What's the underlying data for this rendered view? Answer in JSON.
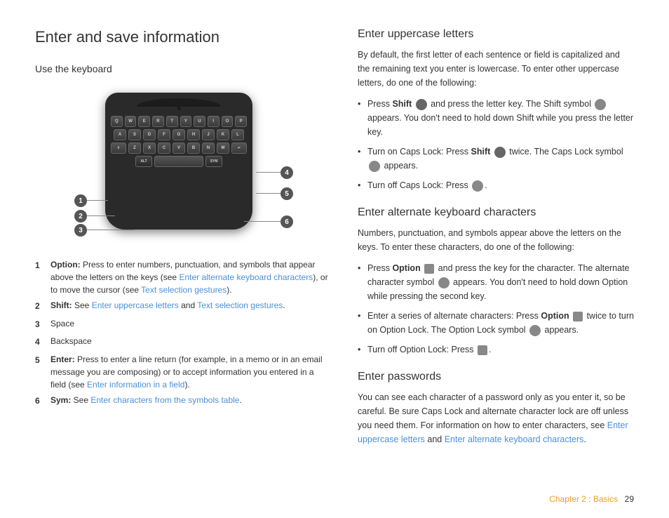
{
  "page": {
    "title": "Enter and save information",
    "left": {
      "section_title": "Use the keyboard",
      "legend": [
        {
          "num": "1",
          "label": "Option:",
          "text": " Press to enter numbers, punctuation, and symbols that appear above the letters on the keys (see ",
          "link1_text": "Enter alternate keyboard characters",
          "link1_href": "#",
          "text2": "), or to move the cursor (see ",
          "link2_text": "Text selection gestures",
          "link2_href": "#",
          "text3": ")."
        },
        {
          "num": "2",
          "label": "Shift:",
          "text": " See ",
          "link1_text": "Enter uppercase letters",
          "link1_href": "#",
          "text2": " and ",
          "link2_text": "Text selection gestures",
          "link2_href": "#",
          "text3": "."
        },
        {
          "num": "3",
          "label": "Space",
          "text": "",
          "link1_text": "",
          "text2": "",
          "link2_text": "",
          "text3": ""
        },
        {
          "num": "4",
          "label": "Backspace",
          "text": "",
          "link1_text": "",
          "text2": "",
          "link2_text": "",
          "text3": ""
        },
        {
          "num": "5",
          "label": "Enter:",
          "text": " Press to enter a line return (for example, in a memo or in an email message you are composing) or to accept information you entered in a field (see ",
          "link1_text": "Enter information in a field",
          "link1_href": "#",
          "text2": ").",
          "link2_text": "",
          "text3": ""
        },
        {
          "num": "6",
          "label": "Sym:",
          "text": " See ",
          "link1_text": "Enter characters from the symbols table",
          "link1_href": "#",
          "text2": ".",
          "link2_text": "",
          "text3": ""
        }
      ]
    },
    "right": {
      "sections": [
        {
          "id": "uppercase",
          "title": "Enter uppercase letters",
          "intro": "By default, the first letter of each sentence or field is capitalized and the remaining text you enter is lowercase. To enter other uppercase letters, do one of the following:",
          "bullets": [
            "Press <b>Shift</b> and press the letter key. The Shift symbol appears. You don't need to hold down Shift while you press the letter key.",
            "Turn on Caps Lock: Press <b>Shift</b> twice. The Caps Lock symbol appears.",
            "Turn off Caps Lock: Press ."
          ]
        },
        {
          "id": "alternate",
          "title": "Enter alternate keyboard characters",
          "intro": "Numbers, punctuation, and symbols appear above the letters on the keys. To enter these characters, do one of the following:",
          "bullets": [
            "Press <b>Option</b> and press the key for the character. The alternate character symbol appears. You don't need to hold down Option while pressing the second key.",
            "Enter a series of alternate characters: Press <b>Option</b> twice to turn on Option Lock. The Option Lock symbol appears.",
            "Turn off Option Lock: Press ."
          ]
        },
        {
          "id": "passwords",
          "title": "Enter passwords",
          "intro": "You can see each character of a password only as you enter it, so be careful. Be sure Caps Lock and alternate character lock are off unless you need them. For information on how to enter characters, see",
          "link1_text": "Enter uppercase letters",
          "text2": " and ",
          "link2_text": "Enter alternate keyboard characters",
          "text3": "."
        }
      ]
    },
    "footer": {
      "chapter_text": "Chapter 2 : Basics",
      "page_num": "29"
    }
  }
}
